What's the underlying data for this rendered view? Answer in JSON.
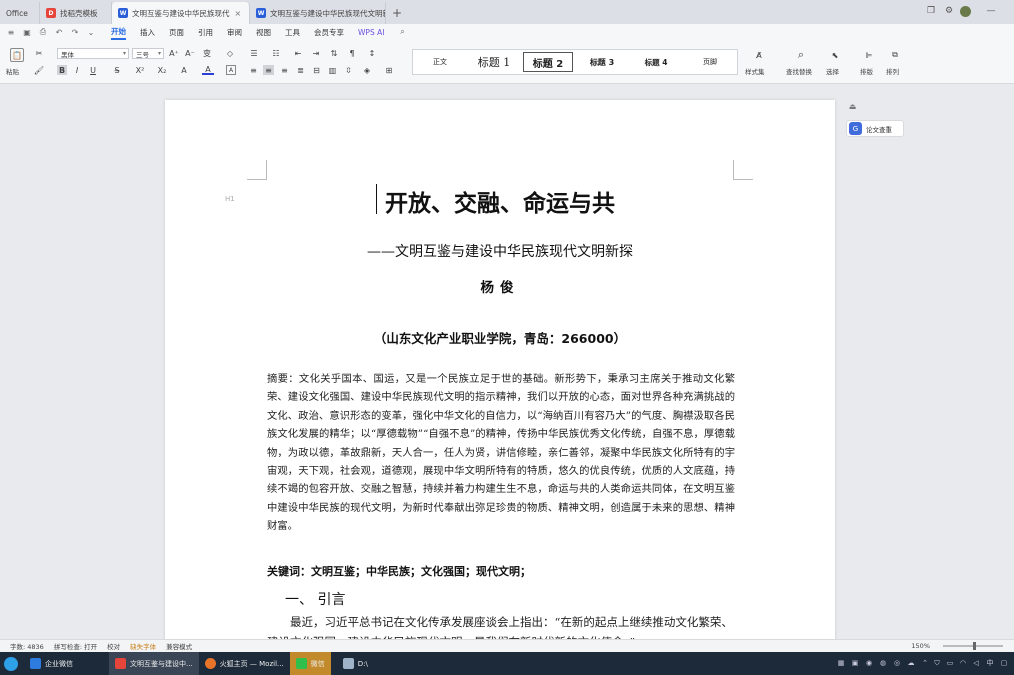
{
  "tabs": [
    {
      "label": "Office"
    },
    {
      "label": "找稻壳模板"
    },
    {
      "label": "文明互鉴与建设中华民族现代"
    },
    {
      "label": "文明互鉴与建设中华民族现代文明新"
    }
  ],
  "menu": [
    "开始",
    "插入",
    "页面",
    "引用",
    "审阅",
    "视图",
    "工具",
    "会员专享",
    "WPS AI"
  ],
  "ribbon": {
    "paste_label": "粘贴",
    "font_name": "黑体",
    "font_size": "三号",
    "styles": [
      "正文",
      "标题 1",
      "标题 2",
      "标题 3",
      "标题 4",
      "页脚"
    ],
    "style_set_label": "样式集",
    "find_replace_label": "查找替换",
    "select_label": "选择",
    "layout_label": "排版",
    "arrange_label": "排列"
  },
  "side_tool_label": "论文查重",
  "document": {
    "para_mark": "H1",
    "title": "开放、交融、命运与共",
    "subtitle": "——文明互鉴与建设中华民族现代文明新探",
    "author": "杨俊",
    "institution": "（山东文化产业职业学院，青岛：266000）",
    "abstract": "摘要：文化关乎国本、国运，又是一个民族立足于世的基础。新形势下，秉承习主席关于推动文化繁荣、建设文化强国、建设中华民族现代文明的指示精神，我们以开放的心态，面对世界各种充满挑战的文化、政治、意识形态的变革，强化中华文化的自信力，以“海纳百川有容乃大”的气度、胸襟汲取各民族文化发展的精华；以“厚德载物”“自强不息”的精神，传扬中华民族优秀文化传统，自强不息，厚德载物，为政以德，革故鼎新，天人合一，任人为贤，讲信修睦，亲仁善邻，凝聚中华民族文化所特有的宇宙观，天下观，社会观，道德观，展现中华文明所特有的特质，悠久的优良传统，优质的人文底蕴，持续不竭的包容开放、交融之智慧，持续并着力构建生生不息，命运与共的人类命运共同体，在文明互鉴中建设中华民族的现代文明，为新时代奉献出弥足珍贵的物质、精神文明，创造属于未来的思想、精神财富。",
    "keywords": "关键词：文明互鉴；中华民族；文化强国；现代文明；",
    "heading1": "一、 引言",
    "para1": "最近，习近平总书记在文化传承发展座谈会上指出：“在新的起点上继续推动文化繁荣、建设文化强国、建设中华民族现代文明，是我们在新时代新的文化使命。”"
  },
  "status": {
    "word_count": "字数: 4836",
    "spellcheck": "拼写检查: 打开",
    "proofread": "校对",
    "missing_font": "缺失字体",
    "mode": "兼容模式",
    "zoom": "150%"
  },
  "taskbar": [
    {
      "label": "企业微信"
    },
    {
      "label": "文明互鉴与建设中..."
    },
    {
      "label": "火狐主页 — Mozil..."
    },
    {
      "label": "微信"
    },
    {
      "label": "D:\\"
    }
  ],
  "tray_text": "中",
  "colors": {
    "accent": "#2b6de5",
    "taskbar": "#1d2a3a",
    "wps_red": "#e5453b",
    "wps_blue": "#2b5fd9"
  }
}
